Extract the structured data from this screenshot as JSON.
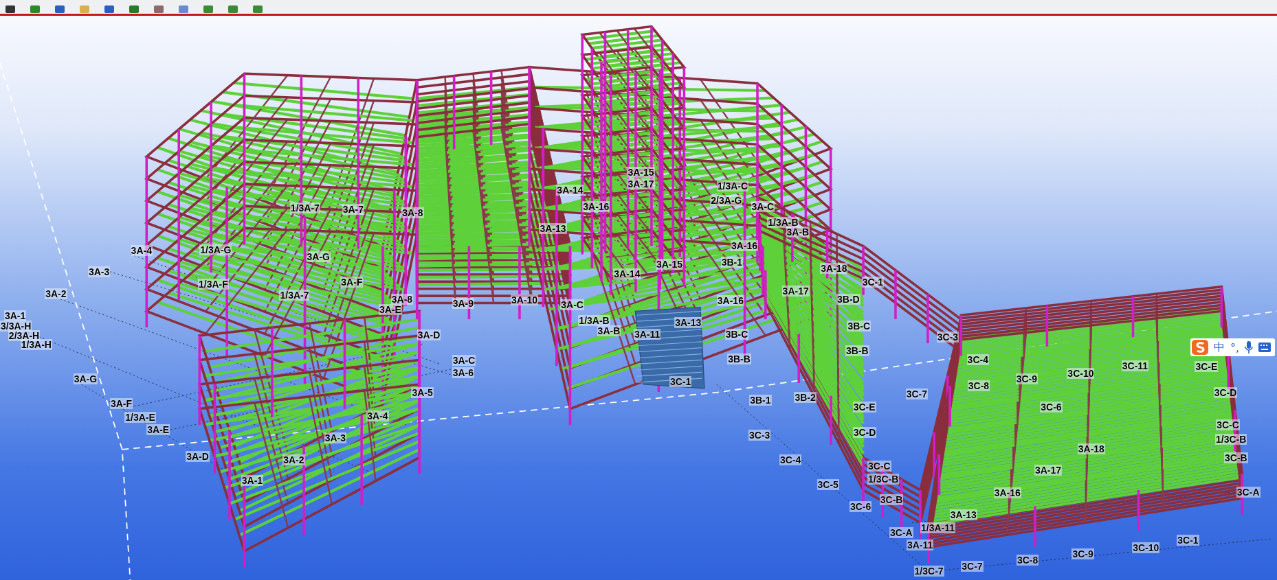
{
  "grid_labels": [
    "3A-3",
    "3A-2",
    "3A-1",
    "3/3A-H",
    "2/3A-H",
    "1/3A-H",
    "3A-G",
    "3A-F",
    "1/3A-E",
    "3A-E",
    "3A-D",
    "3A-1",
    "3A-2",
    "3A-3",
    "3A-4",
    "3A-5",
    "3A-C",
    "3A-6",
    "3A-D",
    "3A-8",
    "3A-E",
    "3A-F",
    "1/3A-7",
    "1/3A-F",
    "3A-4",
    "1/3A-G",
    "3A-G",
    "1/3A-7",
    "3A-7",
    "3A-8",
    "3A-9",
    "3A-10",
    "3A-C",
    "1/3A-B",
    "3A-B",
    "3A-14",
    "3A-16",
    "3A-13",
    "3A-14",
    "3A-15",
    "3A-13",
    "3A-11",
    "3C-1",
    "3A-15",
    "3A-17",
    "1/3A-C",
    "2/3A-G",
    "3A-C",
    "1/3A-B",
    "3A-B",
    "3A-16",
    "3B-1",
    "3A-18",
    "3A-17",
    "3A-16",
    "3B-C",
    "3B-B",
    "3B-1",
    "3B-2",
    "3C-1",
    "3B-D",
    "3B-C",
    "3B-B",
    "3C-3",
    "3C-4",
    "3C-5",
    "3C-6",
    "3C-C",
    "1/3C-B",
    "3C-B",
    "3C-E",
    "3C-D",
    "3C-3",
    "3C-4",
    "3C-8",
    "3C-7",
    "3C-A",
    "1/3A-11",
    "3A-11",
    "3A-13",
    "3A-16",
    "3A-17",
    "3A-18",
    "3C-6",
    "3C-9",
    "3C-10",
    "3C-11",
    "3C-E",
    "3C-D",
    "3C-C",
    "1/3C-B",
    "3C-B",
    "3C-A",
    "3C-7",
    "3C-8",
    "3C-9",
    "3C-10",
    "1/3C-7",
    "3C-1"
  ],
  "ime_toolbar": {
    "language": "中",
    "punctuation": "°,"
  }
}
